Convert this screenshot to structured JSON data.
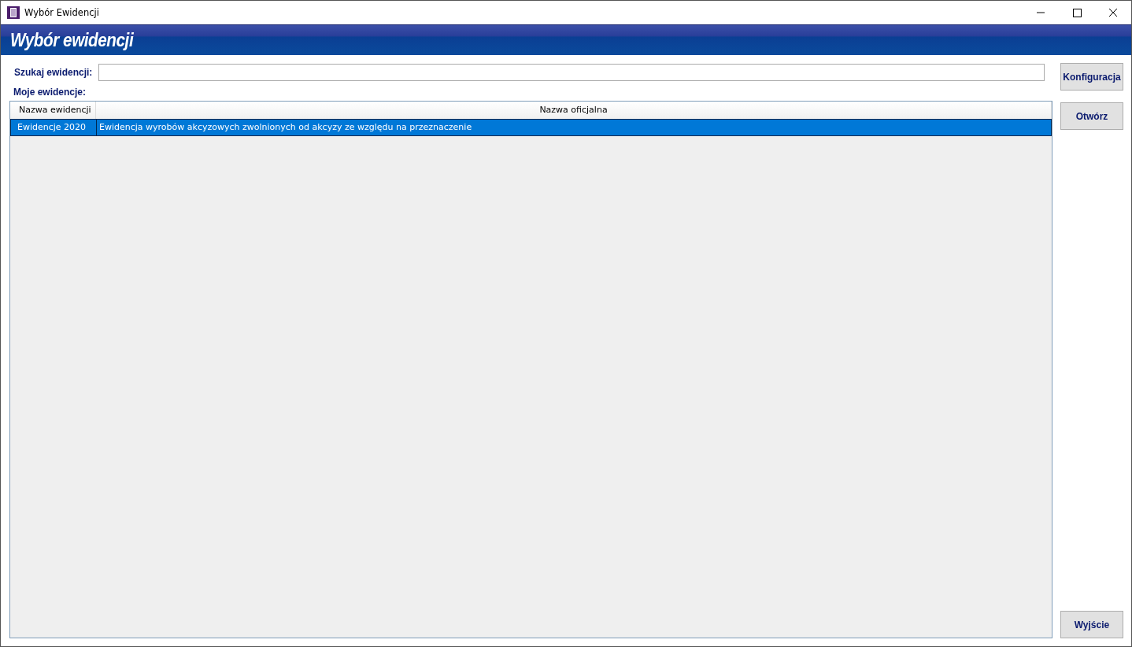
{
  "window": {
    "title": "Wybór Ewidencji"
  },
  "banner": {
    "title": "Wybór ewidencji"
  },
  "search": {
    "label": "Szukaj ewidencji:"
  },
  "list": {
    "label": "Moje ewidencje:",
    "columns": [
      "Nazwa ewidencji",
      "Nazwa oficjalna"
    ],
    "rows": [
      {
        "cells": [
          "Ewidencje 2020",
          "Ewidencja wyrobów akcyzowych zwolnionych od akcyzy ze względu na przeznaczenie"
        ],
        "selected": true
      }
    ]
  },
  "buttons": {
    "top": [
      "Konfiguracja",
      "Otwórz"
    ],
    "bottom": [
      "Wyjście"
    ]
  }
}
